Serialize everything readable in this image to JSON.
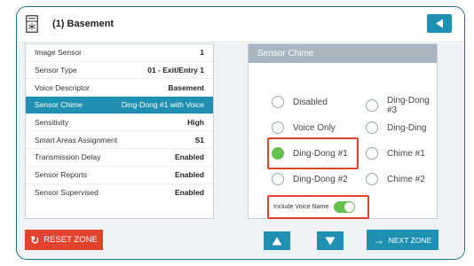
{
  "header": {
    "title": "(1) Basement",
    "device_icon": "sensor-device-icon",
    "back_icon": "back-arrow-icon"
  },
  "sensor_list": [
    {
      "label": "Image Sensor",
      "value": "1"
    },
    {
      "label": "Sensor Type",
      "value": "01 - Exit/Entry 1"
    },
    {
      "label": "Voice Descriptor",
      "value": "Basement"
    },
    {
      "label": "Sensor Chime",
      "value": "Ding-Dong #1 with Voice",
      "selected": true
    },
    {
      "label": "Sensitivity",
      "value": "High"
    },
    {
      "label": "Smart Areas Assignment",
      "value": "S1"
    },
    {
      "label": "Transmission Delay",
      "value": "Enabled"
    },
    {
      "label": "Sensor Reports",
      "value": "Enabled"
    },
    {
      "label": "Sensor Supervised",
      "value": "Enabled"
    }
  ],
  "chime_panel": {
    "title": "Sensor Chime",
    "options": [
      "Disabled",
      "Ding-Dong #3",
      "Voice Only",
      "Ding-Ding",
      "Ding-Dong #1",
      "Chime #1",
      "Ding-Dong #2",
      "Chime #2"
    ],
    "selected": "Ding-Dong #1",
    "include_voice_label": "Include Voice Name",
    "include_voice_enabled": true
  },
  "footer": {
    "reset_label": "RESET ZONE",
    "next_label": "NEXT ZONE"
  },
  "colors": {
    "accent": "#1f8fb2",
    "danger": "#e2432f",
    "toggle_on": "#64c14f",
    "highlight": "#e0432e"
  }
}
